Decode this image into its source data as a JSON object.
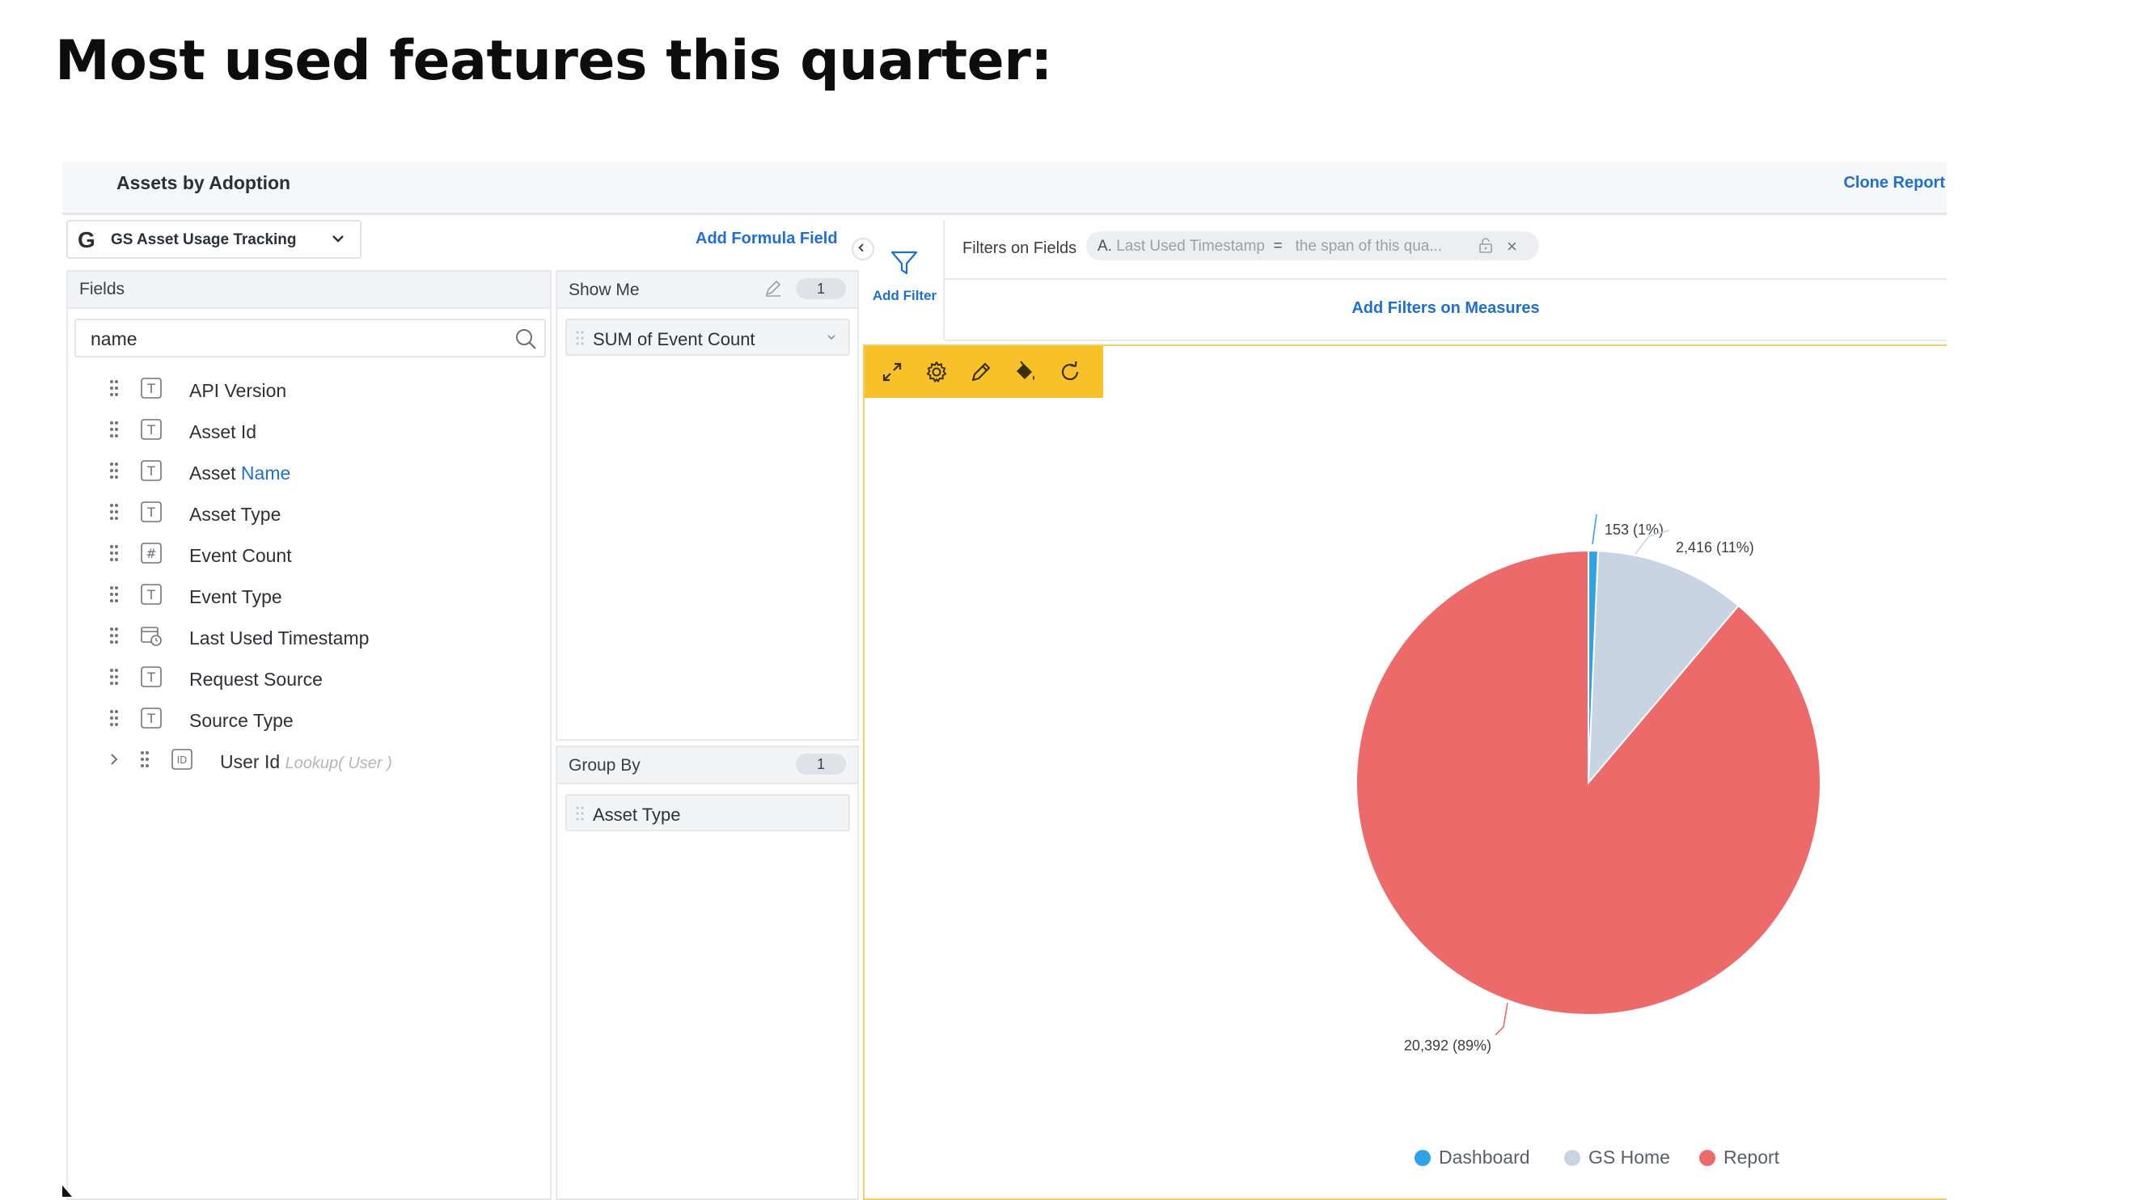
{
  "slide_title": "Most used features this quarter:",
  "header": {
    "title": "Assets by Adoption",
    "clone_report": "Clone Report"
  },
  "source": {
    "logo": "G",
    "name": "GS Asset Usage Tracking"
  },
  "add_formula_field": "Add Formula Field",
  "fields_panel": {
    "title": "Fields",
    "search_value": "name",
    "items": [
      {
        "prefix": "API Version",
        "match": "",
        "suffix": "",
        "type_icon": "text-type-icon",
        "type_glyph": "T"
      },
      {
        "prefix": "Asset Id",
        "match": "",
        "suffix": "",
        "type_icon": "text-type-icon",
        "type_glyph": "T"
      },
      {
        "prefix": "Asset ",
        "match": "Name",
        "suffix": "",
        "type_icon": "text-type-icon",
        "type_glyph": "T"
      },
      {
        "prefix": "Asset Type",
        "match": "",
        "suffix": "",
        "type_icon": "text-type-icon",
        "type_glyph": "T"
      },
      {
        "prefix": "Event Count",
        "match": "",
        "suffix": "",
        "type_icon": "number-type-icon",
        "type_glyph": "#"
      },
      {
        "prefix": "Event Type",
        "match": "",
        "suffix": "",
        "type_icon": "text-type-icon",
        "type_glyph": "T"
      },
      {
        "prefix": "Last Used Timestamp",
        "match": "",
        "suffix": "",
        "type_icon": "datetime-type-icon",
        "type_glyph": ""
      },
      {
        "prefix": "Request Source",
        "match": "",
        "suffix": "",
        "type_icon": "text-type-icon",
        "type_glyph": "T"
      },
      {
        "prefix": "Source Type",
        "match": "",
        "suffix": "",
        "type_icon": "text-type-icon",
        "type_glyph": "T"
      }
    ],
    "lookup_item": {
      "label": "User Id",
      "lookup": "Lookup( User )",
      "type_glyph": "ID"
    }
  },
  "show_me": {
    "title": "Show Me",
    "count": "1",
    "measure": "SUM of Event Count"
  },
  "group_by": {
    "title": "Group By",
    "count": "1",
    "dimension": "Asset Type"
  },
  "filters": {
    "add_filter": "Add Filter",
    "label": "Filters on Fields",
    "chip_prefix": "A.",
    "chip_field": "Last Used Timestamp",
    "chip_operator": "=",
    "chip_value": "the span of this qua...",
    "chip_close": "×",
    "add_filters_measures": "Add Filters on Measures"
  },
  "toolbar_icons": [
    "expand-icon",
    "settings-icon",
    "pencil-icon",
    "paint-bucket-icon",
    "refresh-icon"
  ],
  "colors": {
    "accent": "#1f6fd1",
    "toolbar": "#f8c12a",
    "dashboard": "#2ea4e6",
    "gs_home": "#c9d4e2",
    "report": "#ec6a6a"
  },
  "chart_data": {
    "type": "pie",
    "slices": [
      {
        "name": "Dashboard",
        "value": 153,
        "label": "153 (1%)",
        "color": "#2ea4e6"
      },
      {
        "name": "GS Home",
        "value": 2416,
        "label": "2,416 (11%)",
        "color": "#c9d4e2"
      },
      {
        "name": "Report",
        "value": 20392,
        "label": "20,392 (89%)",
        "color": "#ec6a6a"
      }
    ],
    "legend_position": "bottom"
  }
}
